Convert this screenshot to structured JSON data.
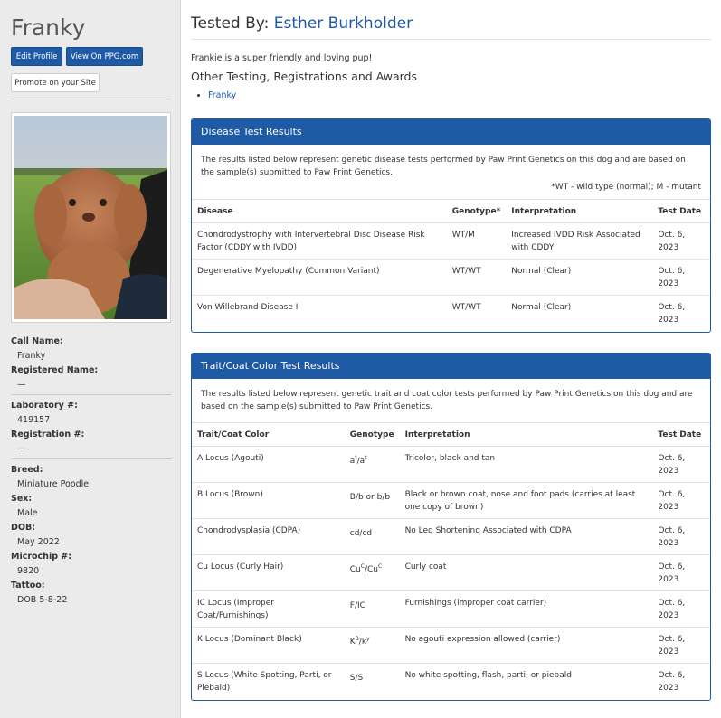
{
  "dog": {
    "name": "Franky",
    "buttons": {
      "edit": "Edit Profile",
      "ppg": "View On PPG.com",
      "promote": "Promote on your Site"
    },
    "photo_alt": "Franky photo",
    "info": [
      {
        "label": "Call Name:",
        "value": "Franky"
      },
      {
        "label": "Registered Name:",
        "value": "—"
      },
      {
        "label": "Laboratory #:",
        "value": "419157"
      },
      {
        "label": "Registration #:",
        "value": "—"
      },
      {
        "label": "Breed:",
        "value": "Miniature Poodle"
      },
      {
        "label": "Sex:",
        "value": "Male"
      },
      {
        "label": "DOB:",
        "value": "May 2022"
      },
      {
        "label": "Microchip #:",
        "value": "9820"
      },
      {
        "label": "Tattoo:",
        "value": "DOB 5-8-22"
      }
    ]
  },
  "main": {
    "tested_by_label": "Tested By:",
    "tester": "Esther Burkholder",
    "description": "Frankie is a super friendly and loving pup!",
    "other_title": "Other Testing, Registrations and Awards",
    "other_links": [
      "Franky"
    ]
  },
  "disease": {
    "title": "Disease Test Results",
    "intro": "The results listed below represent genetic disease tests performed by Paw Print Genetics on this dog and are based on the sample(s) submitted to Paw Print Genetics.",
    "note": "*WT - wild type (normal); M - mutant",
    "headers": [
      "Disease",
      "Genotype*",
      "Interpretation",
      "Test Date"
    ],
    "rows": [
      {
        "name": "Chondrodystrophy with Intervertebral Disc Disease Risk Factor (CDDY with IVDD)",
        "genotype": "WT/M",
        "interpretation": "Increased IVDD Risk Associated with CDDY",
        "date": "Oct. 6, 2023"
      },
      {
        "name": "Degenerative Myelopathy (Common Variant)",
        "genotype": "WT/WT",
        "interpretation": "Normal (Clear)",
        "date": "Oct. 6, 2023"
      },
      {
        "name": "Von Willebrand Disease I",
        "genotype": "WT/WT",
        "interpretation": "Normal (Clear)",
        "date": "Oct. 6, 2023"
      }
    ]
  },
  "trait": {
    "title": "Trait/Coat Color Test Results",
    "intro": "The results listed below represent genetic trait and coat color tests performed by Paw Print Genetics on this dog and are based on the sample(s) submitted to Paw Print Genetics.",
    "headers": [
      "Trait/Coat Color",
      "Genotype",
      "Interpretation",
      "Test Date"
    ],
    "rows": [
      {
        "name": "A Locus (Agouti)",
        "g1": "a",
        "s1": "t",
        "g2": "/a",
        "s2": "t",
        "interpretation": "Tricolor, black and tan",
        "date": "Oct. 6, 2023"
      },
      {
        "name": "B Locus (Brown)",
        "g1": "B/b or b/b",
        "s1": "",
        "g2": "",
        "s2": "",
        "interpretation": "Black or brown coat, nose and foot pads (carries at least one copy of brown)",
        "date": "Oct. 6, 2023"
      },
      {
        "name": "Chondrodysplasia (CDPA)",
        "g1": "cd/cd",
        "s1": "",
        "g2": "",
        "s2": "",
        "interpretation": "No Leg Shortening Associated with CDPA",
        "date": "Oct. 6, 2023"
      },
      {
        "name": "Cu Locus (Curly Hair)",
        "g1": "Cu",
        "s1": "C",
        "g2": "/Cu",
        "s2": "C",
        "interpretation": "Curly coat",
        "date": "Oct. 6, 2023"
      },
      {
        "name": "IC Locus (Improper Coat/Furnishings)",
        "g1": "F/IC",
        "s1": "",
        "g2": "",
        "s2": "",
        "interpretation": "Furnishings (improper coat carrier)",
        "date": "Oct. 6, 2023"
      },
      {
        "name": "K Locus (Dominant Black)",
        "g1": "K",
        "s1": "B",
        "g2": "/k",
        "s2": "y",
        "interpretation": "No agouti expression allowed (carrier)",
        "date": "Oct. 6, 2023"
      },
      {
        "name": "S Locus (White Spotting, Parti, or Piebald)",
        "g1": "S/S",
        "s1": "",
        "g2": "",
        "s2": "",
        "interpretation": "No white spotting, flash, parti, or piebald",
        "date": "Oct. 6, 2023"
      }
    ]
  },
  "colors": {
    "accent": "#1f5aa6",
    "sidebar": "#ebebeb"
  }
}
